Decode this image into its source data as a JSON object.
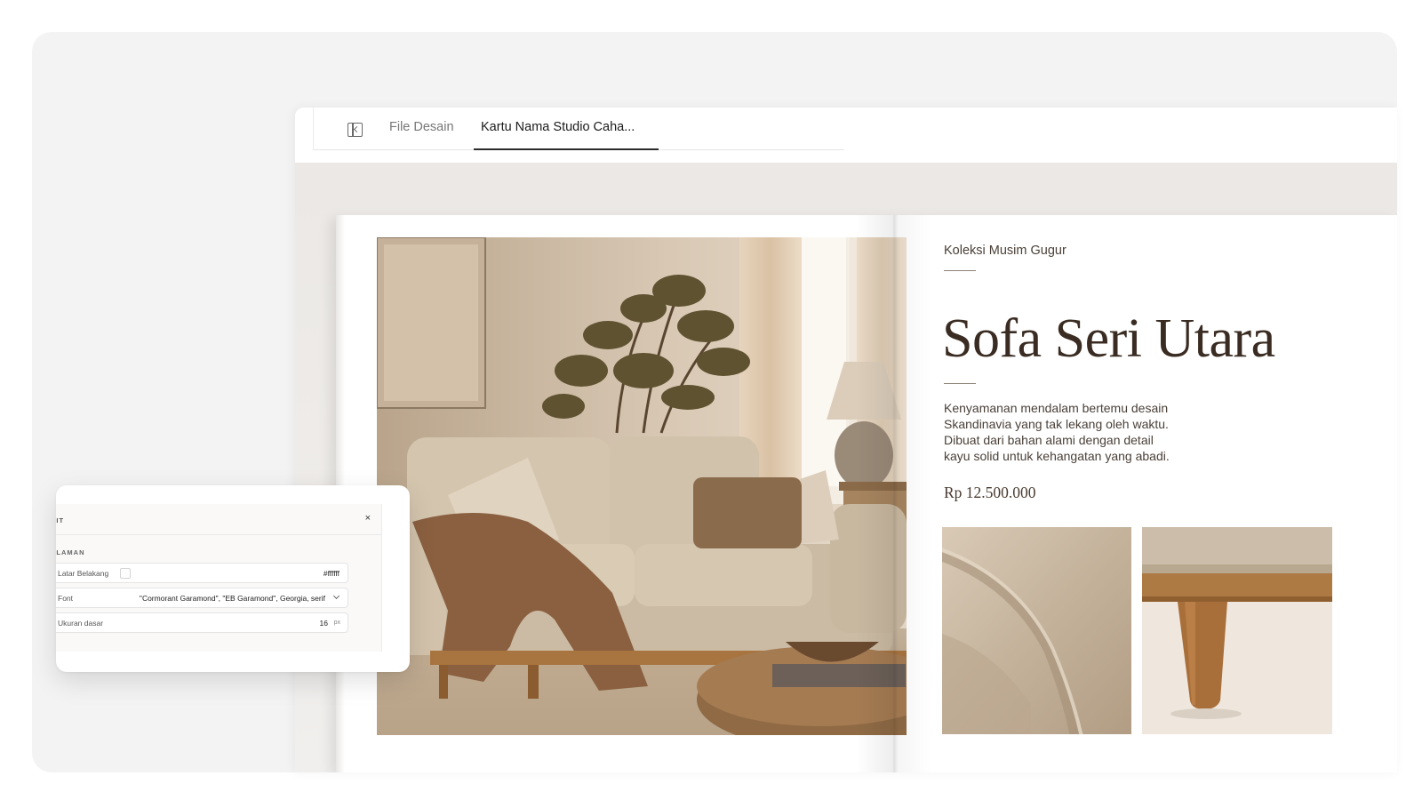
{
  "tabs": {
    "files_label": "File Desain",
    "active_label": "Kartu Nama Studio Caha..."
  },
  "catalog": {
    "eyebrow": "Koleksi Musim Gugur",
    "title": "Sofa Seri Utara",
    "description": "Kenyamanan mendalam bertemu desain Skandinavia yang tak lekang oleh waktu. Dibuat dari bahan alami dengan detail kayu solid untuk kehangatan yang abadi.",
    "price": "Rp 12.500.000"
  },
  "inspector": {
    "title": "DIT",
    "close_glyph": "×",
    "section": "ALAMAN",
    "background_label": "Latar Belakang",
    "background_value": "#ffffff",
    "font_label": "Font",
    "font_value": "\"Cormorant Garamond\", \"EB Garamond\", Georgia, serif",
    "base_size_label": "Ukuran dasar",
    "base_size_value": "16",
    "base_size_unit": "px"
  },
  "colors": {
    "backdrop": "#f3f3f3",
    "canvas": "#ebe8e5",
    "title_brown": "#3a2c22",
    "sofa_linen": "#cfc0ab",
    "wood": "#a8743f"
  },
  "icons": {
    "panel_toggle": "sidebar-panel-icon",
    "close": "close-icon",
    "chevron": "chevron-down-icon"
  }
}
